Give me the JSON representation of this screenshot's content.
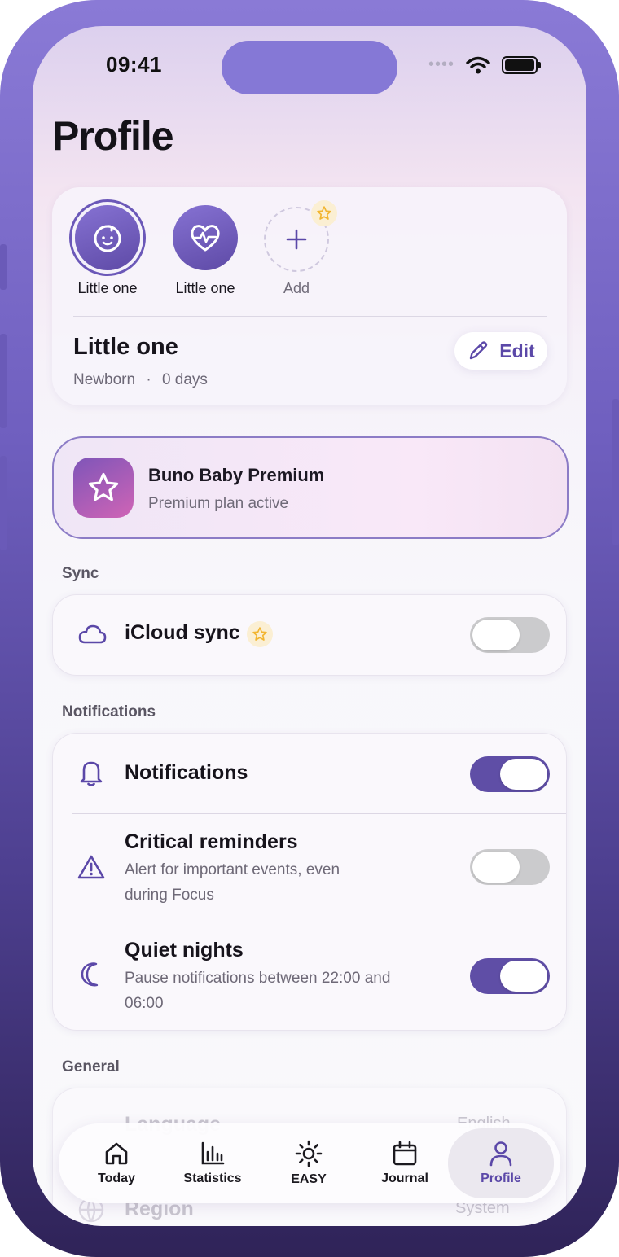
{
  "status_bar": {
    "time": "09:41",
    "signal_icon": "signal-dots-icon",
    "wifi_icon": "wifi-icon",
    "battery_icon": "battery-icon"
  },
  "header": {
    "title": "Profile"
  },
  "profiles": {
    "items": [
      {
        "label": "Little one",
        "icon": "baby-face-icon",
        "selected": true
      },
      {
        "label": "Little one",
        "icon": "heart-pulse-icon",
        "selected": false
      },
      {
        "label": "Add",
        "icon": "plus-icon",
        "premium_badge": "star-icon"
      }
    ],
    "current": {
      "name": "Little one",
      "stage": "Newborn",
      "separator": "·",
      "age": "0 days"
    },
    "edit_label": "Edit"
  },
  "premium": {
    "title": "Buno Baby Premium",
    "subtitle": "Premium plan active"
  },
  "sync": {
    "section_label": "Sync",
    "icloud": {
      "label": "iCloud sync",
      "enabled": false
    }
  },
  "notifications": {
    "section_label": "Notifications",
    "items": [
      {
        "title": "Notifications",
        "enabled": true
      },
      {
        "title": "Critical reminders",
        "subtitle_line1": "Alert for important events, even",
        "subtitle_line2": "during Focus",
        "enabled": false
      },
      {
        "title": "Quiet nights",
        "subtitle_line1": "Pause notifications between 22:00 and",
        "subtitle_line2": "06:00",
        "enabled": true
      }
    ]
  },
  "general": {
    "section_label": "General",
    "items": [
      {
        "label": "Language",
        "value": "English"
      },
      {
        "label": "Region",
        "value": "System"
      }
    ]
  },
  "tabbar": {
    "tabs": [
      {
        "label": "Today",
        "icon": "home-icon"
      },
      {
        "label": "Statistics",
        "icon": "bar-chart-icon"
      },
      {
        "label": "EASY",
        "icon": "sun-icon"
      },
      {
        "label": "Journal",
        "icon": "calendar-icon"
      },
      {
        "label": "Profile",
        "icon": "person-icon",
        "active": true
      }
    ]
  },
  "colors": {
    "accent": "#5f4ea6",
    "frame": "#6f5fbf",
    "premium_gradient_start": "#7e55b8",
    "premium_gradient_end": "#d064b6",
    "star_badge": "#f2b530"
  }
}
